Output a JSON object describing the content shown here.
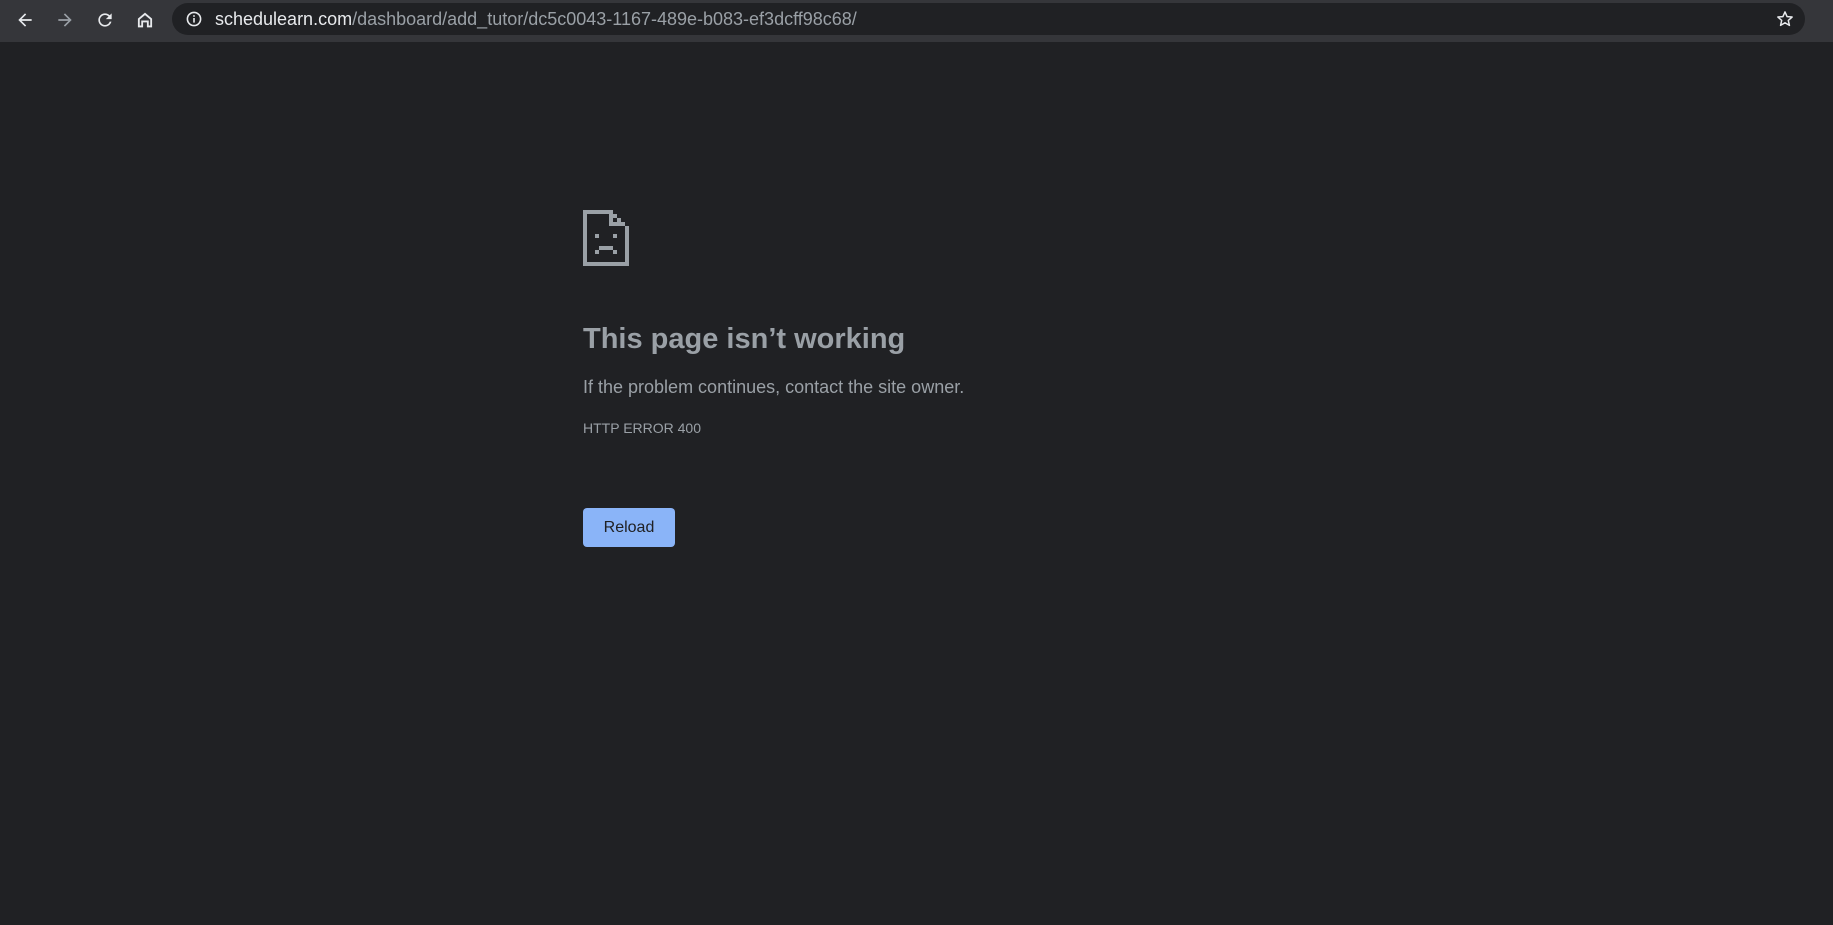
{
  "browser": {
    "url_host": "schedulearn.com",
    "url_path": "/dashboard/add_tutor/dc5c0043-1167-489e-b083-ef3dcff98c68/",
    "icons": {
      "back": "arrow-left-icon",
      "forward": "arrow-right-icon",
      "reload": "refresh-icon",
      "home": "home-icon",
      "site_info": "info-icon",
      "bookmark": "star-icon"
    },
    "colors": {
      "toolbar": "#35363a",
      "omnibox": "#202124",
      "page": "#202124",
      "icon_active": "#e8eaed",
      "icon_disabled": "#9aa0a6"
    }
  },
  "error": {
    "icon": "sad-page-icon",
    "title": "This page isn’t working",
    "description": "If the problem continues, contact the site owner.",
    "code": "HTTP ERROR 400",
    "reload_label": "Reload",
    "colors": {
      "text": "#9aa0a6",
      "button": "#8ab4f8",
      "button_text": "#202124"
    }
  }
}
